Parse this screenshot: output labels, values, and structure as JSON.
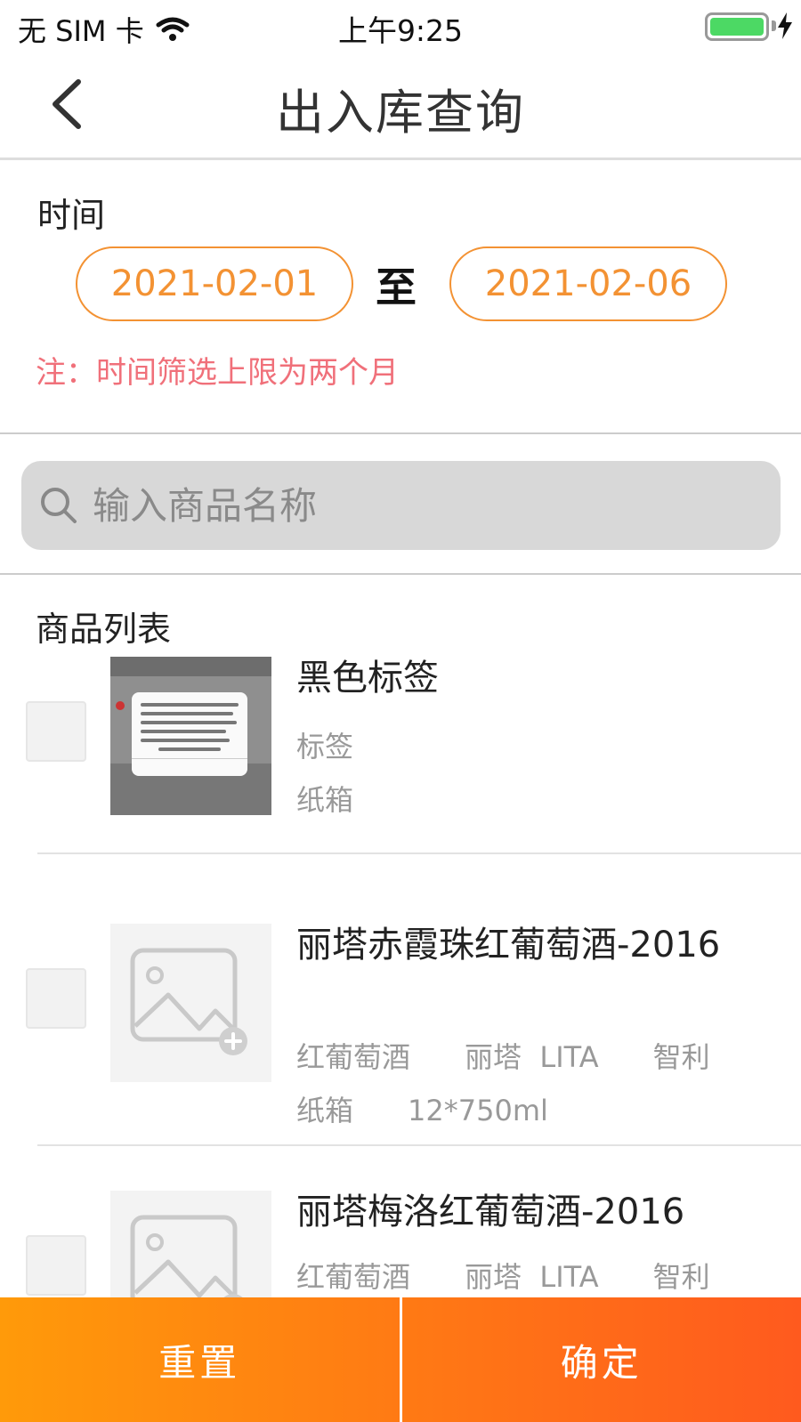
{
  "status_bar": {
    "carrier": "无 SIM 卡",
    "time": "上午9:25",
    "battery_level": 1.0
  },
  "nav": {
    "title": "出入库查询",
    "back_icon": "chevron-left-icon"
  },
  "time_filter": {
    "label": "时间",
    "start_date": "2021-02-01",
    "to_label": "至",
    "end_date": "2021-02-06",
    "note": "注：时间筛选上限为两个月"
  },
  "search": {
    "placeholder": "输入商品名称",
    "value": ""
  },
  "product_list": {
    "title": "商品列表",
    "items": [
      {
        "name": "黑色标签",
        "meta_line1": "标签",
        "meta_line2": "纸箱",
        "checked": false
      },
      {
        "name": "丽塔赤霞珠红葡萄酒-2016",
        "meta_line1": "红葡萄酒      丽塔  LITA      智利",
        "meta_line2": "纸箱      12*750ml",
        "checked": false
      },
      {
        "name": "丽塔梅洛红葡萄酒-2016",
        "meta_line1": "红葡萄酒      丽塔  LITA      智利",
        "checked": false
      }
    ]
  },
  "bottom_bar": {
    "reset_label": "重置",
    "confirm_label": "确定"
  },
  "colors": {
    "accent": "#f39233",
    "note": "#f0707a",
    "gradient_start": "#ff9a0a",
    "gradient_end": "#ff5a1e"
  }
}
